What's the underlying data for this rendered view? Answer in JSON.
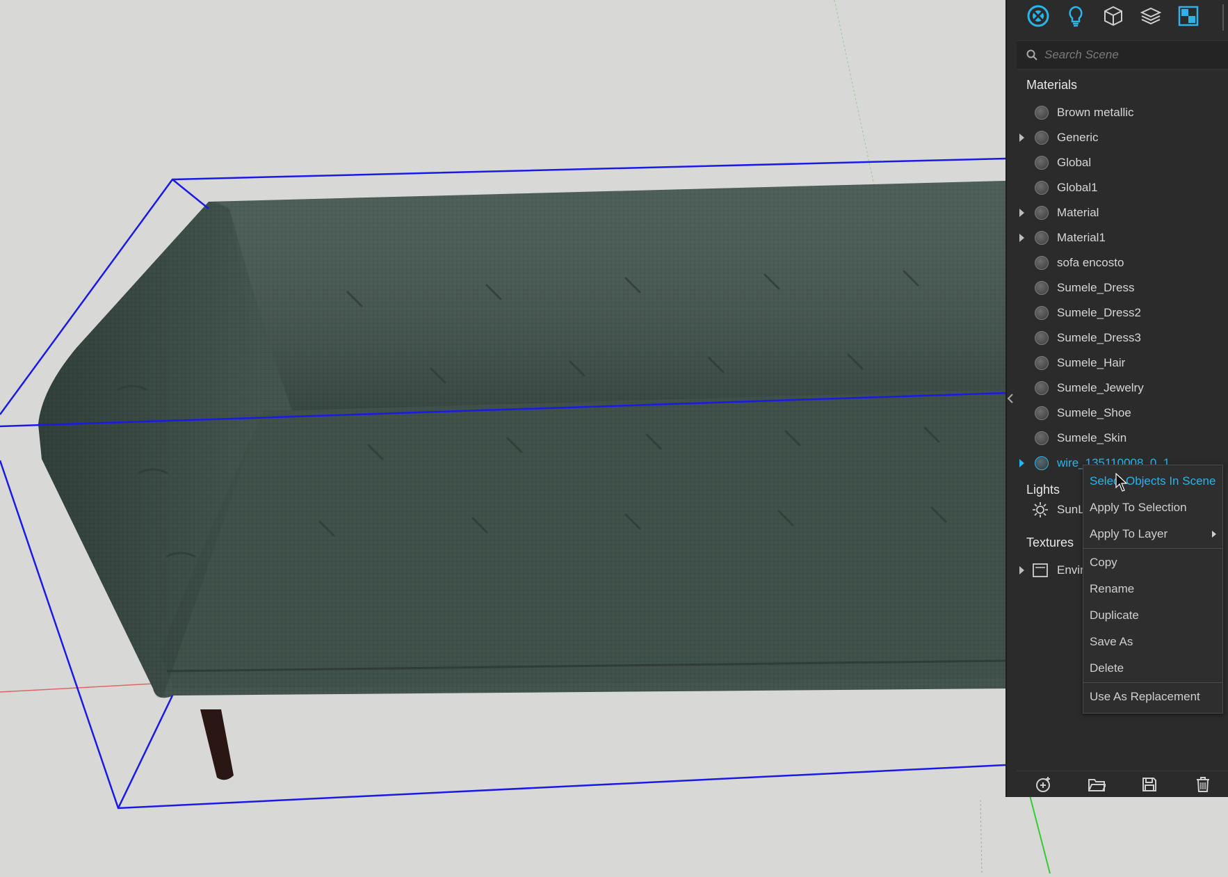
{
  "search": {
    "placeholder": "Search Scene"
  },
  "sections": {
    "materials": "Materials",
    "lights": "Lights",
    "textures": "Textures"
  },
  "materials": [
    {
      "label": "Brown metallic",
      "expandable": false
    },
    {
      "label": "Generic",
      "expandable": true
    },
    {
      "label": "Global",
      "expandable": false
    },
    {
      "label": "Global1",
      "expandable": false
    },
    {
      "label": "Material",
      "expandable": true
    },
    {
      "label": "Material1",
      "expandable": true
    },
    {
      "label": "sofa encosto",
      "expandable": false
    },
    {
      "label": "Sumele_Dress",
      "expandable": false
    },
    {
      "label": "Sumele_Dress2",
      "expandable": false
    },
    {
      "label": "Sumele_Dress3",
      "expandable": false
    },
    {
      "label": "Sumele_Hair",
      "expandable": false
    },
    {
      "label": "Sumele_Jewelry",
      "expandable": false
    },
    {
      "label": "Sumele_Shoe",
      "expandable": false
    },
    {
      "label": "Sumele_Skin",
      "expandable": false
    },
    {
      "label": "wire_135110008_0_1",
      "expandable": true,
      "selected": true
    }
  ],
  "lights": [
    {
      "label": "SunL"
    }
  ],
  "textures": [
    {
      "label": "Envir"
    }
  ],
  "context_menu": {
    "items": [
      {
        "label": "Select Objects In Scene",
        "active": true
      },
      {
        "label": "Apply To Selection"
      },
      {
        "label": "Apply To Layer",
        "submenu": true
      },
      {
        "divider": true
      },
      {
        "label": "Copy"
      },
      {
        "label": "Rename"
      },
      {
        "label": "Duplicate"
      },
      {
        "label": "Save As"
      },
      {
        "label": "Delete"
      },
      {
        "divider": true
      },
      {
        "label": "Use As Replacement"
      }
    ]
  },
  "colors": {
    "accent": "#29b4ea",
    "panel_bg": "#2b2b2c",
    "viewport_bg": "#d8d8d6",
    "sofa": "#44564f",
    "bbox": "#1a1ae6"
  },
  "icons": {
    "topbar": [
      "materials-icon",
      "lights-icon",
      "model-icon",
      "layers-icon",
      "textures-icon"
    ],
    "bottombar": [
      "add-material-icon",
      "open-folder-icon",
      "save-icon",
      "trash-icon"
    ]
  }
}
